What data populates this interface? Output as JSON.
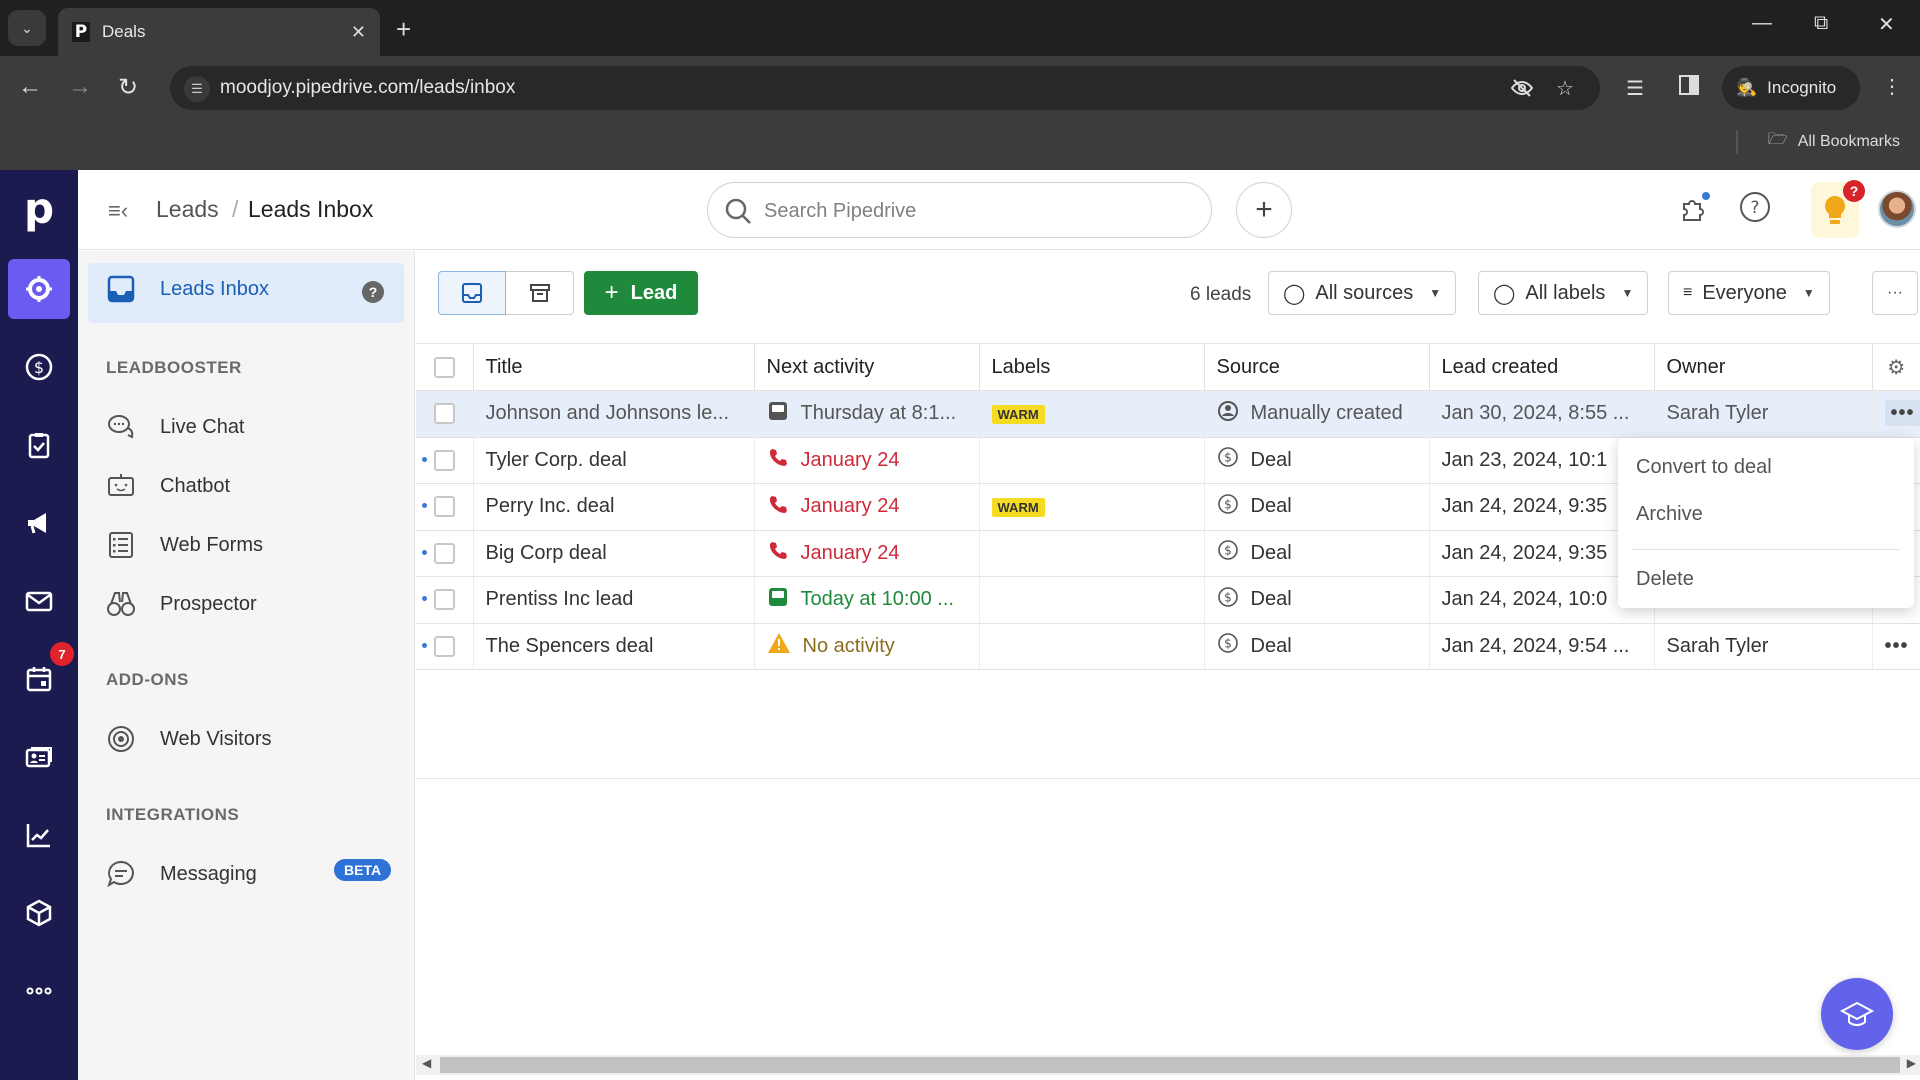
{
  "browser": {
    "tab_title": "Deals",
    "tab_favicon": "P",
    "url": "moodjoy.pipedrive.com/leads/inbox",
    "incognito_label": "Incognito",
    "bookmarks_label": "All Bookmarks"
  },
  "header": {
    "breadcrumb_parent": "Leads",
    "breadcrumb_separator": "/",
    "breadcrumb_current": "Leads Inbox",
    "search_placeholder": "Search Pipedrive",
    "help_badge": "?",
    "logo_letter": "p"
  },
  "rail": {
    "calendar_badge": "7",
    "items": [
      "leads-icon",
      "deals-icon",
      "activities-icon",
      "campaigns-icon",
      "mail-icon",
      "calendar-icon",
      "contacts-icon",
      "insights-icon",
      "products-icon",
      "more-icon"
    ]
  },
  "sidebar": {
    "active_item": "Leads Inbox",
    "help": "?",
    "sections": [
      {
        "heading": "LEADBOOSTER",
        "items": [
          "Live Chat",
          "Chatbot",
          "Web Forms",
          "Prospector"
        ]
      },
      {
        "heading": "ADD-ONS",
        "items": [
          "Web Visitors"
        ]
      },
      {
        "heading": "INTEGRATIONS",
        "items": [
          "Messaging"
        ]
      }
    ],
    "messaging_badge": "BETA"
  },
  "toolbar": {
    "add_lead_label": "Lead",
    "leads_count": "6 leads",
    "sources_filter": "All sources",
    "labels_filter": "All labels",
    "owner_filter": "Everyone",
    "more": "···"
  },
  "table": {
    "columns": [
      "Title",
      "Next activity",
      "Labels",
      "Source",
      "Lead created",
      "Owner"
    ],
    "rows": [
      {
        "title": "Johnson and Johnsons le...",
        "activity": "Thursday at 8:1...",
        "activity_type": "meeting",
        "activity_status": "upcoming",
        "label": "WARM",
        "source": "Manually created",
        "source_icon": "person",
        "created": "Jan 30, 2024, 8:55 ...",
        "owner": "Sarah Tyler",
        "unread": false,
        "highlighted": true
      },
      {
        "title": "Tyler Corp. deal",
        "activity": "January 24",
        "activity_type": "call",
        "activity_status": "overdue",
        "label": "",
        "source": "Deal",
        "source_icon": "dollar",
        "created": "Jan 23, 2024, 10:1",
        "owner": "",
        "unread": true,
        "highlighted": false
      },
      {
        "title": "Perry Inc. deal",
        "activity": "January 24",
        "activity_type": "call",
        "activity_status": "overdue",
        "label": "WARM",
        "source": "Deal",
        "source_icon": "dollar",
        "created": "Jan 24, 2024, 9:35",
        "owner": "",
        "unread": true,
        "highlighted": false
      },
      {
        "title": "Big Corp deal",
        "activity": "January 24",
        "activity_type": "call",
        "activity_status": "overdue",
        "label": "",
        "source": "Deal",
        "source_icon": "dollar",
        "created": "Jan 24, 2024, 9:35",
        "owner": "",
        "unread": true,
        "highlighted": false
      },
      {
        "title": "Prentiss Inc lead",
        "activity": "Today at 10:00 ...",
        "activity_type": "meeting",
        "activity_status": "today",
        "label": "",
        "source": "Deal",
        "source_icon": "dollar",
        "created": "Jan 24, 2024, 10:0",
        "owner": "",
        "unread": true,
        "highlighted": false
      },
      {
        "title": "The Spencers deal",
        "activity": "No activity",
        "activity_type": "warning",
        "activity_status": "none",
        "label": "",
        "source": "Deal",
        "source_icon": "dollar",
        "created": "Jan 24, 2024, 9:54 ...",
        "owner": "Sarah Tyler",
        "unread": true,
        "highlighted": false
      }
    ]
  },
  "context_menu": {
    "items": [
      "Convert to deal",
      "Archive",
      "Delete"
    ]
  },
  "colors": {
    "rail_bg": "#1b1b4f",
    "rail_active": "#6a5cf0",
    "primary_green": "#1f8a3b",
    "overdue_red": "#cf2a3a",
    "warm_label": "#f5dc22",
    "row_highlight": "#e6eef9",
    "beta_blue": "#2e72d8",
    "fab": "#6362ea"
  }
}
